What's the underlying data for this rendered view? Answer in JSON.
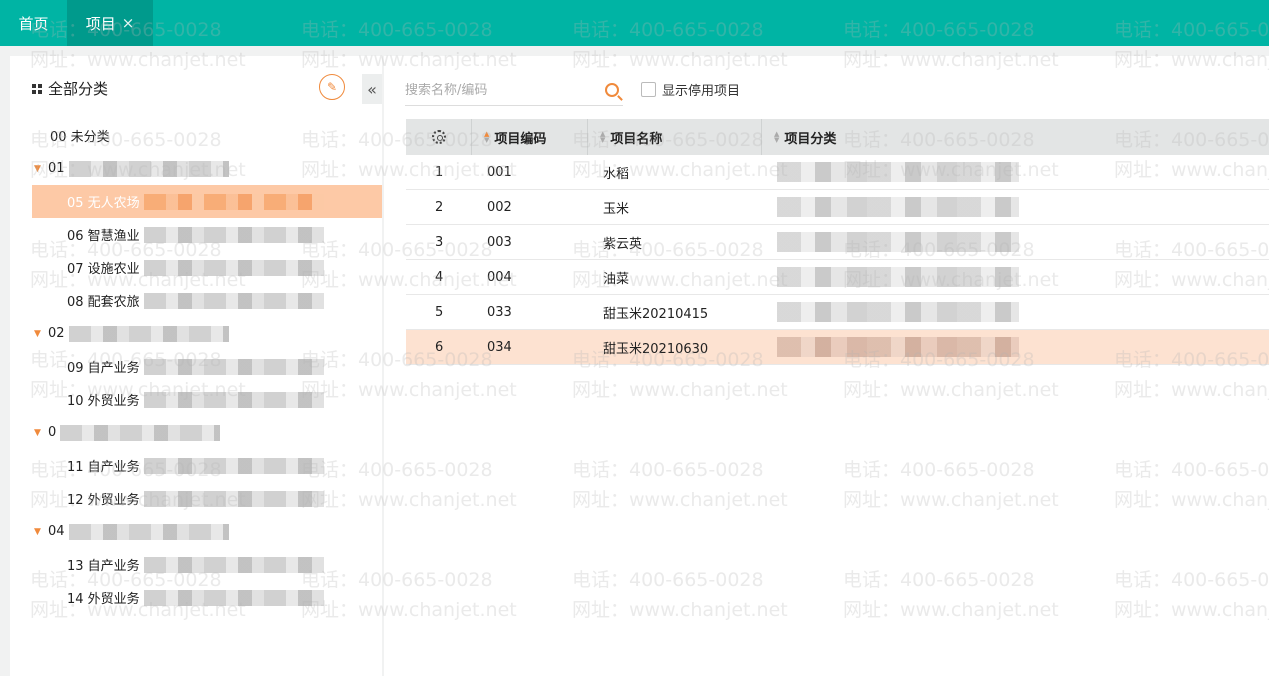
{
  "tabs": {
    "home_label": "首页",
    "project_label": "项目",
    "close_symbol": "×"
  },
  "sidebar": {
    "title": "全部分类",
    "items": [
      {
        "label": "00 未分类",
        "type": "root"
      },
      {
        "label": "01",
        "type": "group"
      },
      {
        "label": "05 无人农场",
        "type": "child",
        "selected": true
      },
      {
        "label": "06 智慧渔业",
        "type": "child"
      },
      {
        "label": "07 设施农业",
        "type": "child"
      },
      {
        "label": "08 配套农旅",
        "type": "child"
      },
      {
        "label": "02",
        "type": "group"
      },
      {
        "label": "09 自产业务",
        "type": "child"
      },
      {
        "label": "10 外贸业务",
        "type": "child"
      },
      {
        "label": "0",
        "type": "group"
      },
      {
        "label": "11 自产业务",
        "type": "child"
      },
      {
        "label": "12 外贸业务",
        "type": "child"
      },
      {
        "label": "04",
        "type": "group"
      },
      {
        "label": "13 自产业务",
        "type": "child"
      },
      {
        "label": "14 外贸业务",
        "type": "child"
      }
    ]
  },
  "toolbar": {
    "search_placeholder": "搜索名称/编码",
    "show_disabled_label": "显示停用项目"
  },
  "table": {
    "headers": {
      "code": "项目编码",
      "name": "项目名称",
      "category": "项目分类"
    },
    "rows": [
      {
        "index": "1",
        "code": "001",
        "name": "水稻"
      },
      {
        "index": "2",
        "code": "002",
        "name": "玉米"
      },
      {
        "index": "3",
        "code": "003",
        "name": "紫云英"
      },
      {
        "index": "4",
        "code": "004",
        "name": "油菜"
      },
      {
        "index": "5",
        "code": "033",
        "name": "甜玉米20210415"
      },
      {
        "index": "6",
        "code": "034",
        "name": "甜玉米20210630",
        "selected": true
      }
    ]
  },
  "watermark": {
    "phone": "电话：400-665-0028",
    "site": "网址：www.chanjet.net"
  },
  "colors": {
    "topbar": "#00b4a4",
    "active_tab": "#009a8c",
    "accent": "#f08a3c",
    "selected_tree": "#fdc9a6",
    "selected_row": "#fde2d1"
  }
}
